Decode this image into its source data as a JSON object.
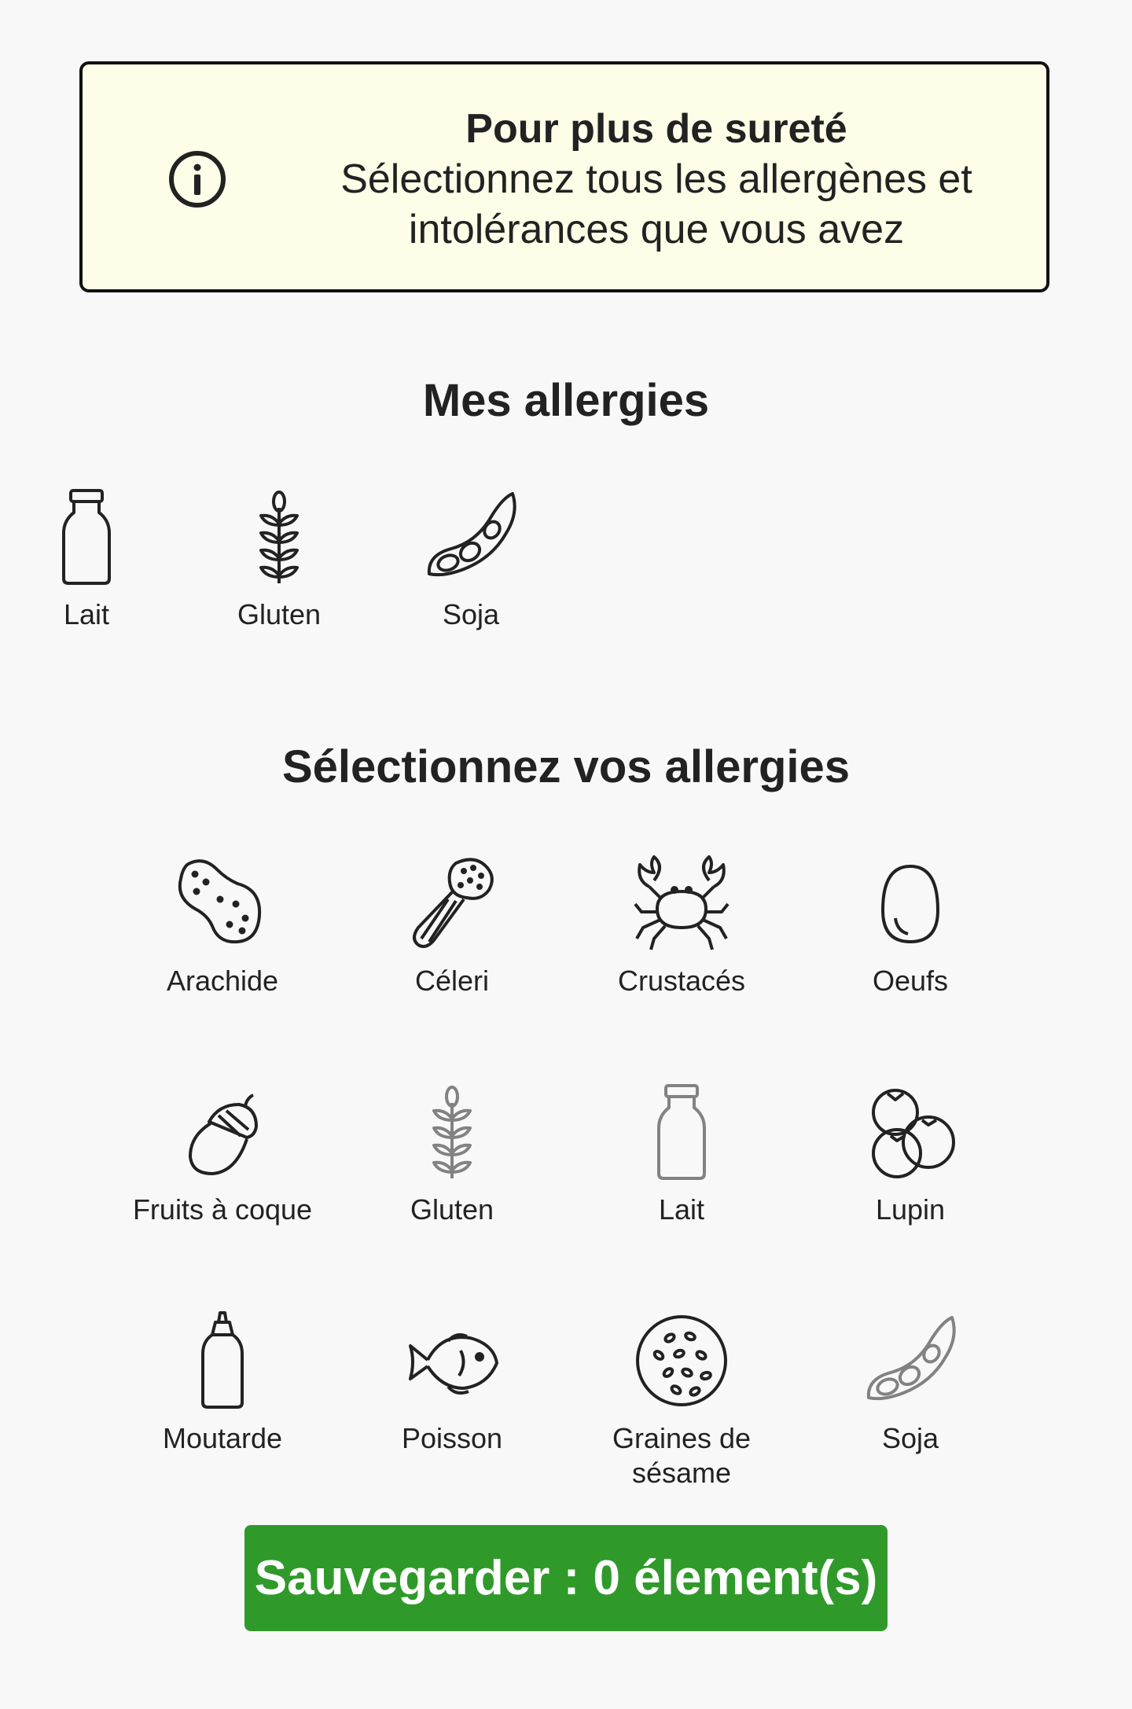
{
  "info": {
    "icon": "info-circle-icon",
    "title": "Pour plus de sureté",
    "body": "Sélectionnez tous les allergènes et intolérances que vous avez"
  },
  "my_allergies": {
    "title": "Mes allergies",
    "items": [
      {
        "label": "Lait",
        "icon": "milk-bottle-icon"
      },
      {
        "label": "Gluten",
        "icon": "wheat-icon"
      },
      {
        "label": "Soja",
        "icon": "soy-pod-icon"
      }
    ]
  },
  "select_allergies": {
    "title": "Sélectionnez vos allergies",
    "items": [
      {
        "label": "Arachide",
        "icon": "peanut-icon"
      },
      {
        "label": "Céleri",
        "icon": "celery-icon"
      },
      {
        "label": "Crustacés",
        "icon": "crab-icon"
      },
      {
        "label": "Oeufs",
        "icon": "egg-icon"
      },
      {
        "label": "Fruits à coque",
        "icon": "acorn-icon"
      },
      {
        "label": "Gluten",
        "icon": "wheat-icon"
      },
      {
        "label": "Lait",
        "icon": "milk-bottle-icon"
      },
      {
        "label": "Lupin",
        "icon": "lupin-icon"
      },
      {
        "label": "Moutarde",
        "icon": "mustard-bottle-icon"
      },
      {
        "label": "Poisson",
        "icon": "fish-icon"
      },
      {
        "label": "Graines de sésame",
        "icon": "sesame-icon"
      },
      {
        "label": "Soja",
        "icon": "soy-pod-icon"
      }
    ]
  },
  "save_button": {
    "label": "Sauvegarder : 0 élement(s)",
    "color": "#2f9a2a"
  }
}
